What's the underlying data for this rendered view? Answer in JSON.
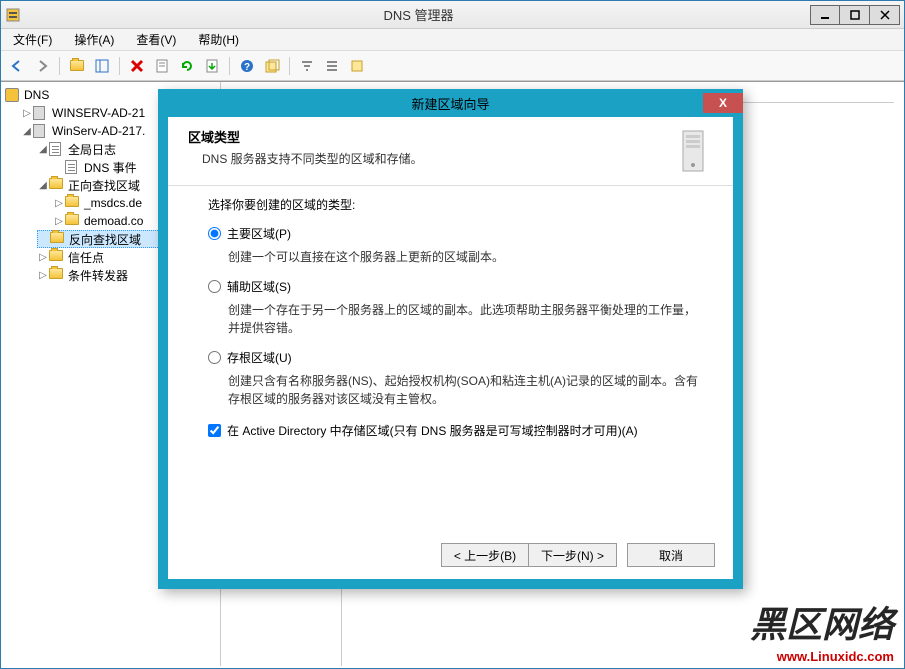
{
  "window": {
    "title": "DNS 管理器"
  },
  "menu": {
    "file": "文件(F)",
    "action": "操作(A)",
    "view": "查看(V)",
    "help": "帮助(H)"
  },
  "tree": {
    "root": "DNS",
    "servers": [
      "WINSERV-AD-21",
      "WinServ-AD-217."
    ],
    "global_log": "全局日志",
    "dns_events": "DNS 事件",
    "forward_zone": "正向查找区域",
    "zones": [
      "_msdcs.de",
      "demoad.co"
    ],
    "reverse_zone": "反向查找区域",
    "trust_points": "信任点",
    "conditional_fwd": "条件转发器"
  },
  "wizard": {
    "title": "新建区域向导",
    "header_title": "区域类型",
    "header_sub": "DNS 服务器支持不同类型的区域和存储。",
    "prompt": "选择你要创建的区域的类型:",
    "opt_primary_label": "主要区域(P)",
    "opt_primary_desc": "创建一个可以直接在这个服务器上更新的区域副本。",
    "opt_secondary_label": "辅助区域(S)",
    "opt_secondary_desc": "创建一个存在于另一个服务器上的区域的副本。此选项帮助主服务器平衡处理的工作量，并提供容错。",
    "opt_stub_label": "存根区域(U)",
    "opt_stub_desc": "创建只含有名称服务器(NS)、起始授权机构(SOA)和粘连主机(A)记录的区域的副本。含有存根区域的服务器对该区域没有主管权。",
    "checkbox_label": "在 Active Directory 中存储区域(只有 DNS 服务器是可写域控制器时才可用)(A)",
    "btn_back": "< 上一步(B)",
    "btn_next": "下一步(N) >",
    "btn_cancel": "取消"
  },
  "watermark": {
    "brand": "黑区网络",
    "url": "www.Linuxidc.com"
  }
}
